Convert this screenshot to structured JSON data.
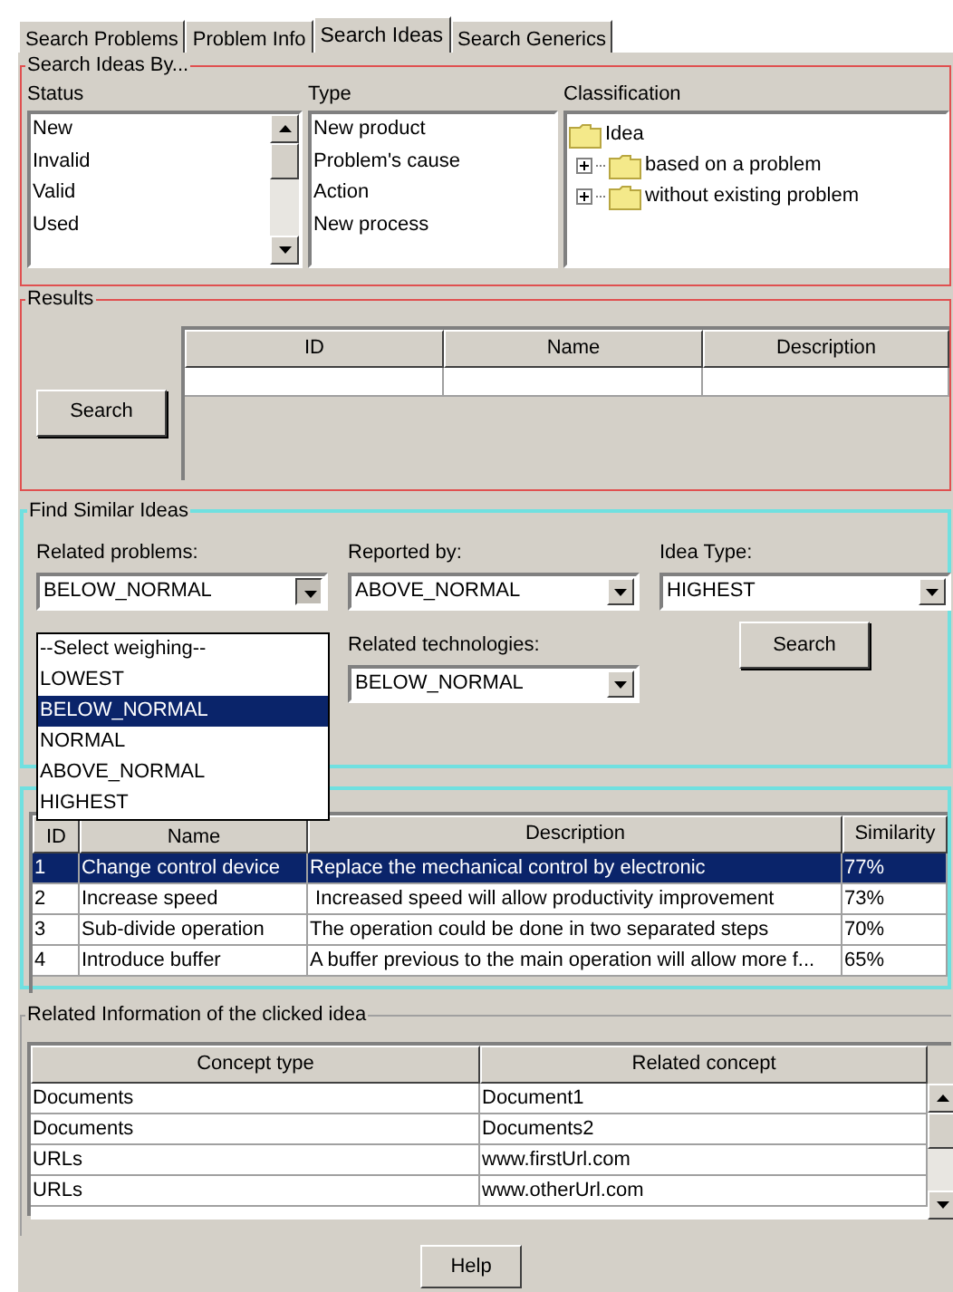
{
  "tabs": [
    {
      "label": "Search Problems",
      "selected": false
    },
    {
      "label": "Problem Info",
      "selected": false
    },
    {
      "label": "Search Ideas",
      "selected": true
    },
    {
      "label": "Search Generics",
      "selected": false
    }
  ],
  "search_ideas_by": {
    "title": "Search Ideas By...",
    "status": {
      "label": "Status",
      "items": [
        "New",
        "Invalid",
        "Valid",
        "Used"
      ]
    },
    "type": {
      "label": "Type",
      "items": [
        "New product",
        "Problem's cause",
        "Action",
        "New process"
      ]
    },
    "classification": {
      "label": "Classification",
      "tree": [
        {
          "label": "Idea",
          "children": [
            {
              "label": "based on a problem",
              "expanded": false
            },
            {
              "label": "without existing problem",
              "expanded": false
            }
          ]
        }
      ]
    }
  },
  "results": {
    "title": "Results",
    "search_button": "Search",
    "columns": [
      "ID",
      "Name",
      "Description"
    ]
  },
  "find_similar": {
    "title": "Find Similar Ideas",
    "fields": [
      {
        "label": "Related problems:",
        "value": "BELOW_NORMAL",
        "open": true
      },
      {
        "label": "Reported by:",
        "value": "ABOVE_NORMAL",
        "open": false
      },
      {
        "label": "Idea Type:",
        "value": "HIGHEST",
        "open": false
      },
      {
        "label": "Related technologies:",
        "value": "BELOW_NORMAL",
        "open": false
      }
    ],
    "options": [
      {
        "label": "--Select weighing--",
        "selected": false
      },
      {
        "label": "LOWEST",
        "selected": false
      },
      {
        "label": "BELOW_NORMAL",
        "selected": true
      },
      {
        "label": "NORMAL",
        "selected": false
      },
      {
        "label": "ABOVE_NORMAL",
        "selected": false
      },
      {
        "label": "HIGHEST",
        "selected": false
      }
    ],
    "search_button": "Search"
  },
  "ideas_table": {
    "columns": [
      "ID",
      "Name",
      "Description",
      "Similarity"
    ],
    "rows": [
      {
        "cells": [
          "1",
          "Change control device",
          "Replace the mechanical control by electronic",
          "77%"
        ],
        "selected": true
      },
      {
        "cells": [
          "2",
          "Increase speed",
          " Increased speed will allow productivity improvement",
          "73%"
        ],
        "selected": false
      },
      {
        "cells": [
          "3",
          "Sub-divide operation",
          "The operation could be done in two separated steps",
          "70%"
        ],
        "selected": false
      },
      {
        "cells": [
          "4",
          "Introduce buffer",
          "A buffer previous to the main operation will allow more f...",
          "65%"
        ],
        "selected": false
      }
    ]
  },
  "related_info": {
    "title": "Related Information of the clicked idea",
    "columns": [
      "Concept type",
      "Related concept"
    ],
    "rows": [
      [
        "Documents",
        "Document1"
      ],
      [
        "Documents",
        "Documents2"
      ],
      [
        "URLs",
        "www.firstUrl.com"
      ],
      [
        "URLs",
        "www.otherUrl.com"
      ]
    ]
  },
  "help_button": "Help"
}
